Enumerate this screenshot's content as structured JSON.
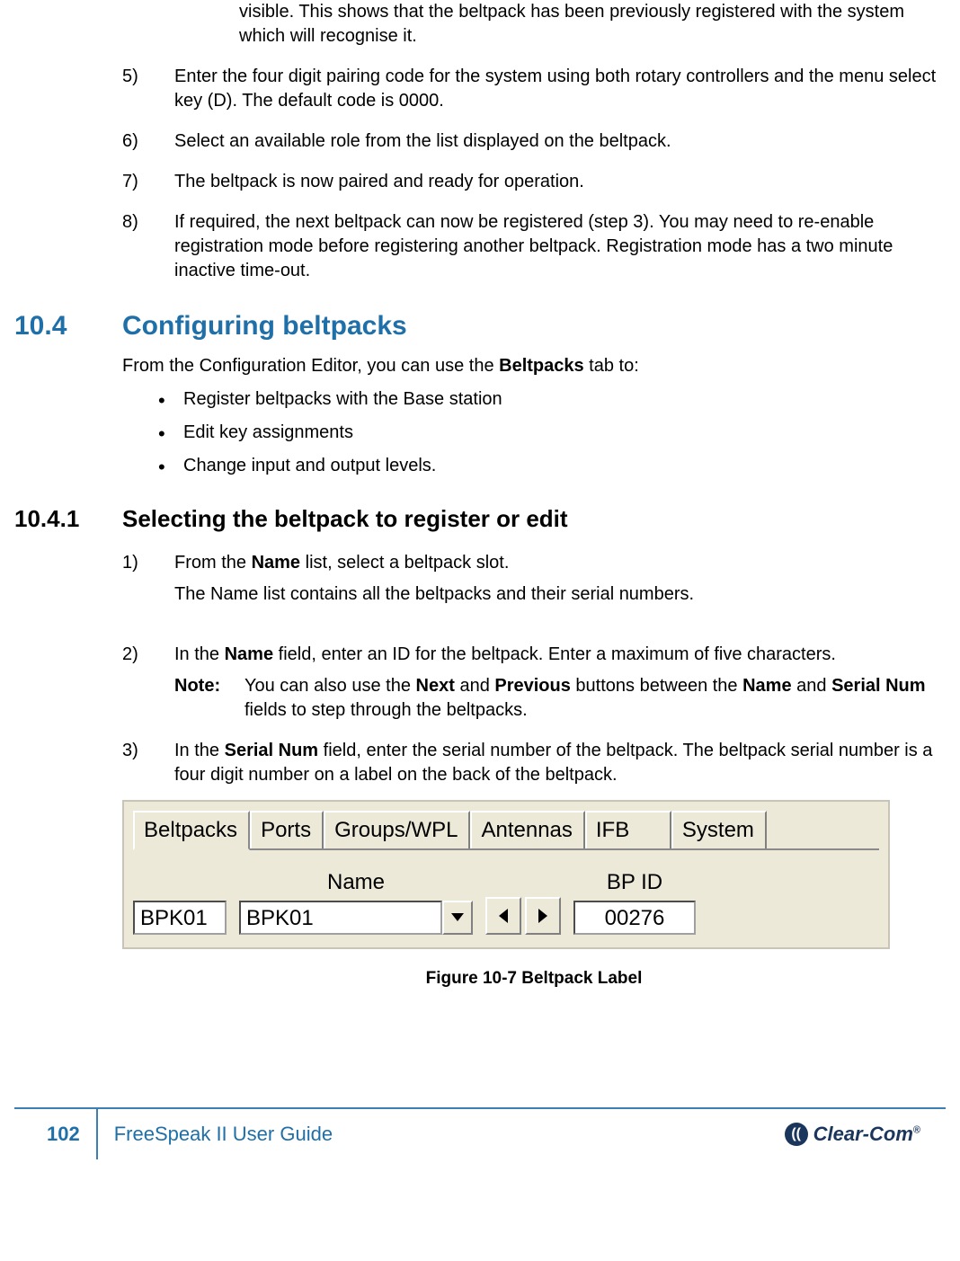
{
  "intro_continuation": "visible.  This shows that the beltpack has been previously registered with the system which will recognise it.",
  "steps_cont": [
    {
      "num": "5)",
      "text": "Enter the four digit pairing code for the system using both rotary controllers and the menu select key (D). The default code is 0000."
    },
    {
      "num": "6)",
      "text": "Select an available role from the list displayed on the beltpack."
    },
    {
      "num": "7)",
      "text": "The beltpack is now paired and ready for operation."
    },
    {
      "num": "8)",
      "text": "If required, the next beltpack can now be registered (step 3). You may need to re-enable registration mode before registering another beltpack.  Registration mode has a two minute inactive time-out."
    }
  ],
  "h2": {
    "num": "10.4",
    "title": "Configuring beltpacks"
  },
  "h2_intro_pre": "From the Configuration Editor, you can use the ",
  "h2_intro_bold": "Beltpacks",
  "h2_intro_post": " tab to:",
  "bullets": [
    "Register beltpacks with the Base station",
    "Edit key assignments",
    "Change input and output levels."
  ],
  "h3": {
    "num": "10.4.1",
    "title": "Selecting the beltpack to register or edit"
  },
  "ord": {
    "i1": {
      "num": "1)",
      "pre": "From the ",
      "b1": "Name",
      "post": " list, select a beltpack slot.",
      "sub": "The Name list contains all the beltpacks and their serial numbers."
    },
    "i2": {
      "num": "2)",
      "pre": "In the ",
      "b1": "Name",
      "post": " field, enter an ID for the beltpack. Enter a maximum of five characters.",
      "note_label": "Note:",
      "note_pre": "You can also use the ",
      "b_next": "Next",
      "mid1": " and ",
      "b_prev": "Previous",
      "mid2": " buttons between the ",
      "b_name": "Name",
      "mid3": " and ",
      "b_sn": "Serial Num",
      "post2": " fields to step through the beltpacks."
    },
    "i3": {
      "num": "3)",
      "pre": "In the ",
      "b1": "Serial Num",
      "post": " field, enter the serial number of the beltpack. The beltpack serial number is a four digit number on a label on the back of the beltpack."
    }
  },
  "widget": {
    "tabs": [
      "Beltpacks",
      "Ports",
      "Groups/WPL",
      "Antennas",
      "IFB",
      "System"
    ],
    "labels": {
      "name": "Name",
      "bpid": "BP ID"
    },
    "values": {
      "short": "BPK01",
      "name": "BPK01",
      "bpid": "00276"
    }
  },
  "figure_caption": "Figure 10-7 Beltpack Label",
  "footer": {
    "page": "102",
    "guide": "FreeSpeak II User Guide",
    "brand": "Clear-Com",
    "reg": "®"
  }
}
